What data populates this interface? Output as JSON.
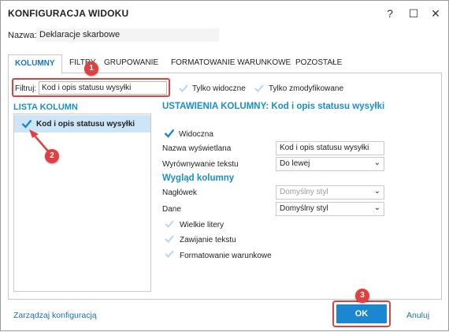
{
  "window": {
    "title": "KONFIGURACJA WIDOKU",
    "help_glyph": "?",
    "maximize_glyph": "☐",
    "close_glyph": "✕"
  },
  "name_row": {
    "label": "Nazwa:",
    "value": "Deklaracje skarbowe"
  },
  "tabs": [
    {
      "label": "KOLUMNY",
      "active": true
    },
    {
      "label": "FILTRY",
      "active": false
    },
    {
      "label": "GRUPOWANIE",
      "active": false
    },
    {
      "label": "FORMATOWANIE WARUNKOWE",
      "active": false
    },
    {
      "label": "POZOSTAŁE",
      "active": false
    }
  ],
  "filter": {
    "label": "Filtruj:",
    "value": "Kod i opis statusu wysyłki"
  },
  "options": {
    "only_visible": "Tylko widoczne",
    "only_modified": "Tylko zmodyfikowane"
  },
  "column_list": {
    "title": "LISTA KOLUMN",
    "items": [
      {
        "label": "Kod i opis statusu wysyłki",
        "checked": true,
        "selected": true
      }
    ]
  },
  "settings": {
    "title": "USTAWIENIA KOLUMNY: Kod i opis statusu wysyłki",
    "visible_label": "Widoczna",
    "display_name_label": "Nazwa wyświetlana",
    "display_name_value": "Kod i opis statusu wysyłki",
    "align_label": "Wyrównywanie tekstu",
    "align_value": "Do lewej",
    "look_title": "Wygląd kolumny",
    "header_label": "Nagłówek",
    "header_value": "Domyślny styl",
    "data_label": "Dane",
    "data_value": "Domyślny styl",
    "uppercase_label": "Wielkie litery",
    "wrap_label": "Zawijanie tekstu",
    "conditional_label": "Formatowanie warunkowe"
  },
  "footer": {
    "manage_link": "Zarządzaj konfiguracją",
    "ok_label": "OK",
    "cancel_label": "Anuluj"
  },
  "badges": [
    "1",
    "2",
    "3"
  ],
  "colors": {
    "accent": "#1a8fc8",
    "primary_button": "#1a87d0",
    "highlight": "#e04040",
    "selection": "#cde6f7"
  }
}
